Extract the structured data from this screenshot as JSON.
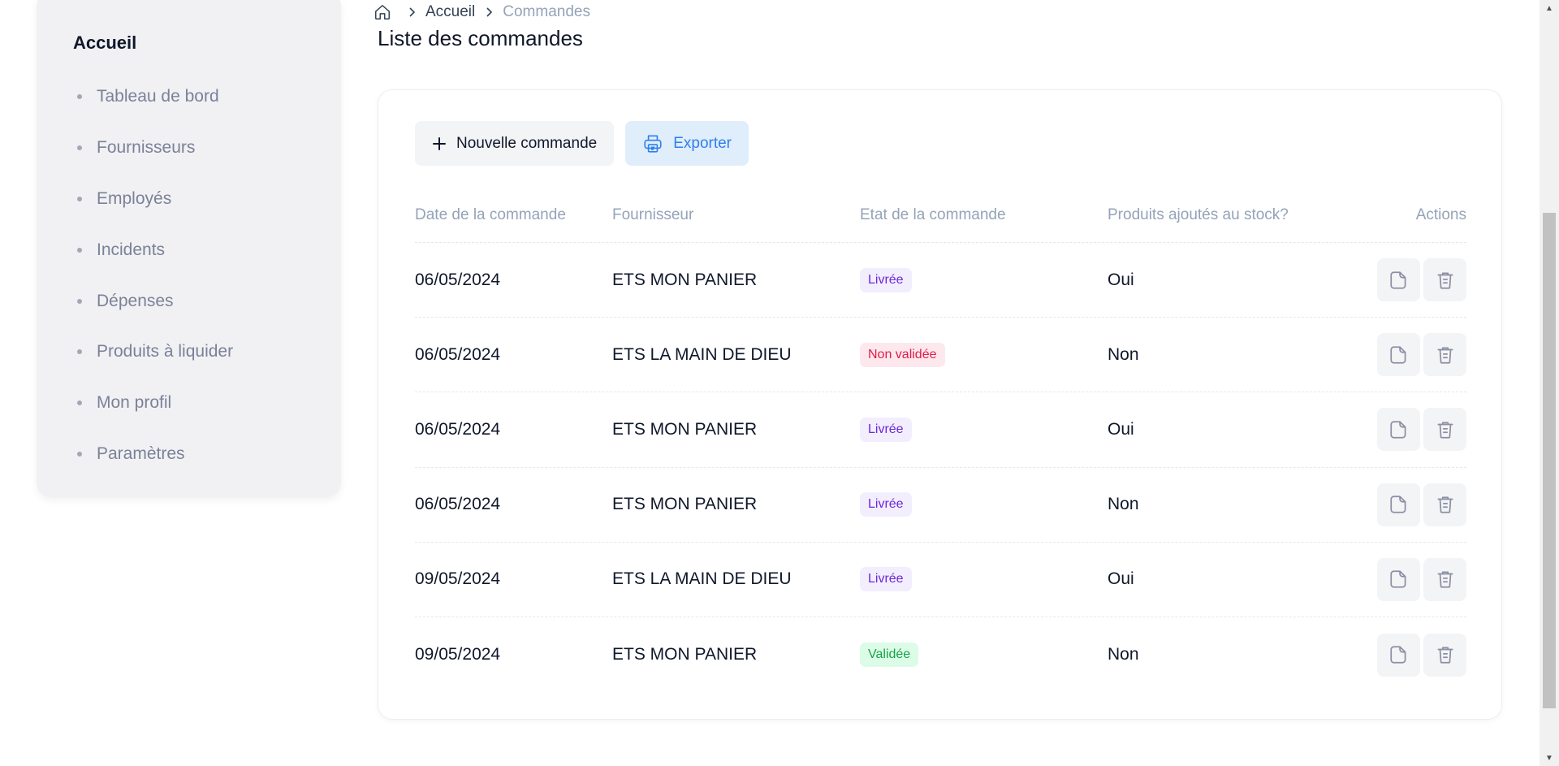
{
  "sidebar": {
    "heading": "Accueil",
    "items": [
      {
        "label": "Tableau de bord"
      },
      {
        "label": "Fournisseurs"
      },
      {
        "label": "Employés"
      },
      {
        "label": "Incidents"
      },
      {
        "label": "Dépenses"
      },
      {
        "label": "Produits à liquider"
      },
      {
        "label": "Mon profil"
      },
      {
        "label": "Paramètres"
      }
    ]
  },
  "breadcrumb": {
    "home_icon": "home-icon",
    "items": [
      "Accueil",
      "Commandes"
    ]
  },
  "page": {
    "title": "Liste des commandes"
  },
  "toolbar": {
    "new_label": "Nouvelle commande",
    "new_icon": "plus-icon",
    "export_label": "Exporter",
    "export_icon": "printer-icon"
  },
  "table": {
    "headers": {
      "date": "Date de la commande",
      "supplier": "Fournisseur",
      "status": "Etat de la commande",
      "stock": "Produits ajoutés au stock?",
      "actions": "Actions"
    },
    "rows": [
      {
        "date": "06/05/2024",
        "supplier": "ETS MON PANIER",
        "status": "Livrée",
        "status_kind": "delivered",
        "stock": "Oui"
      },
      {
        "date": "06/05/2024",
        "supplier": "ETS LA MAIN DE DIEU",
        "status": "Non validée",
        "status_kind": "rejected",
        "stock": "Non"
      },
      {
        "date": "06/05/2024",
        "supplier": "ETS MON PANIER",
        "status": "Livrée",
        "status_kind": "delivered",
        "stock": "Oui"
      },
      {
        "date": "06/05/2024",
        "supplier": "ETS MON PANIER",
        "status": "Livrée",
        "status_kind": "delivered",
        "stock": "Non"
      },
      {
        "date": "09/05/2024",
        "supplier": "ETS LA MAIN DE DIEU",
        "status": "Livrée",
        "status_kind": "delivered",
        "stock": "Oui"
      },
      {
        "date": "09/05/2024",
        "supplier": "ETS MON PANIER",
        "status": "Validée",
        "status_kind": "validated",
        "stock": "Non"
      }
    ],
    "action_icons": [
      "document-icon",
      "trash-icon"
    ]
  },
  "colors": {
    "delivered_bg": "#f3eefe",
    "delivered_text": "#6d28d9",
    "rejected_bg": "#fde8ee",
    "rejected_text": "#e11d48",
    "validated_bg": "#dcfce7",
    "validated_text": "#16a34a",
    "accent": "#2f80ed"
  }
}
